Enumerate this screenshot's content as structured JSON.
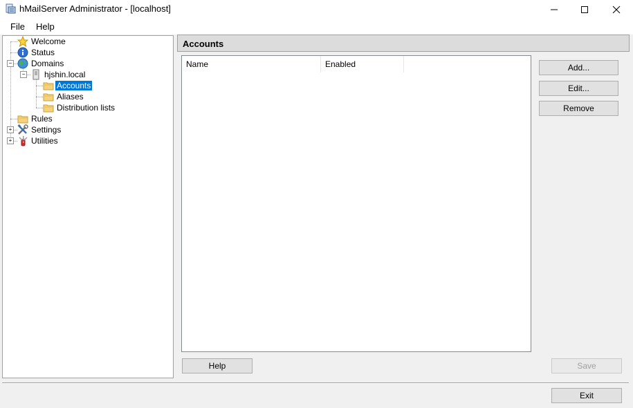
{
  "window": {
    "title": "hMailServer Administrator - [localhost]"
  },
  "menu": [
    {
      "label": "File"
    },
    {
      "label": "Help"
    }
  ],
  "tree": {
    "welcome": "Welcome",
    "status": "Status",
    "domains": "Domains",
    "domain": "hjshin.local",
    "accounts": "Accounts",
    "aliases": "Aliases",
    "distribution_lists": "Distribution lists",
    "rules": "Rules",
    "settings": "Settings",
    "utilities": "Utilities"
  },
  "panel": {
    "title": "Accounts",
    "columns": [
      "Name",
      "Enabled"
    ]
  },
  "buttons": {
    "add": "Add...",
    "edit": "Edit...",
    "remove": "Remove",
    "help": "Help",
    "save": "Save",
    "exit": "Exit"
  },
  "colors": {
    "selection": "#0078d7",
    "folder": "#f5d27b"
  },
  "icons": {
    "welcome": "star-icon",
    "status": "info-icon",
    "domains": "globe-icon",
    "domain": "server-icon",
    "folder": "folder-icon",
    "settings": "tools-icon",
    "utilities": "knife-icon"
  }
}
